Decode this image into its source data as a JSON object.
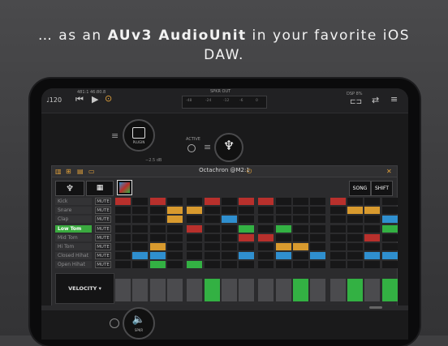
{
  "headline": {
    "prefix": "… as an ",
    "strong": "AUv3 AudioUnit",
    "suffix": " in your favorite iOS",
    "line2": "DAW."
  },
  "topbar": {
    "tempo": "♩120",
    "pos": "481:1  46:80.8",
    "spkr_out": "SPKR OUT",
    "meter_scale": [
      "-48",
      "-24",
      "-12",
      "-6",
      "0"
    ],
    "cpu": "DSP  8%",
    "prev_icon": "skip-back-icon",
    "play_icon": "play-icon",
    "rec_icon": "record-icon"
  },
  "graph": {
    "node1_label": "PLUGIN",
    "active_label": "ACTIVE",
    "gain": "−2.5 dB",
    "spkr": "SPKR"
  },
  "plugin": {
    "title": "Octachron @M2:1",
    "song": "SONG",
    "shift": "SHIFT",
    "velocity": "VELOCITY ▾",
    "mute": "MUTE",
    "rows": [
      {
        "name": "Kick",
        "selected": false
      },
      {
        "name": "Snare",
        "selected": false
      },
      {
        "name": "Clap",
        "selected": false
      },
      {
        "name": "Low Tom",
        "selected": true
      },
      {
        "name": "Mid Tom",
        "selected": false
      },
      {
        "name": "Hi Tom",
        "selected": false
      },
      {
        "name": "Closed Hihat",
        "selected": false
      },
      {
        "name": "Open Hihat",
        "selected": false
      }
    ],
    "colors": {
      "r": "#b8302c",
      "o": "#d89a2e",
      "b": "#2f8fcf",
      "g": "#33b143"
    },
    "grid": [
      "r.r..r.rr...r...",
      "...oo........oo.",
      "...o..b........b",
      "....r..g.g.....g",
      ".......rr.....r.",
      "..o......oo.....",
      ".bb....b.b.b..bb",
      "..g.g............"
    ],
    "velocity_levels": [
      0,
      0,
      0,
      0,
      0,
      1,
      0,
      0,
      0,
      0,
      1,
      0,
      0,
      1,
      0,
      1
    ]
  }
}
